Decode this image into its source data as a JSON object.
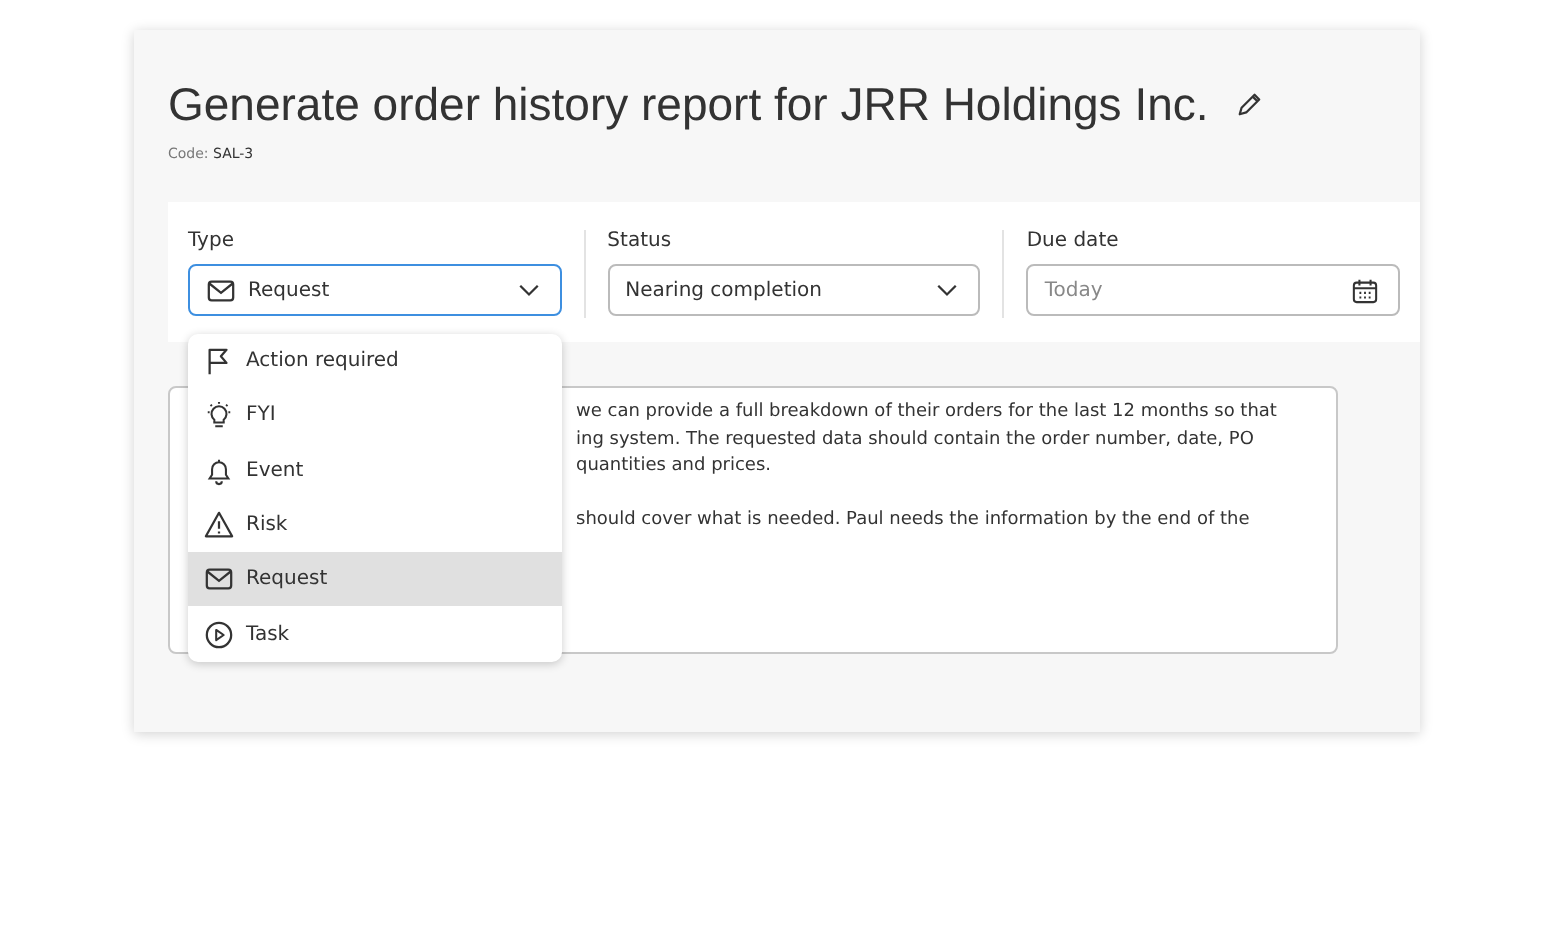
{
  "title": "Generate order history report for JRR Holdings Inc.",
  "code": {
    "label": "Code:",
    "value": "SAL-3"
  },
  "fields": [
    {
      "kind": "select",
      "label": "Type",
      "value": "Request",
      "open": true
    },
    {
      "kind": "select",
      "label": "Status",
      "value": "Nearing completion",
      "open": false
    },
    {
      "kind": "date",
      "label": "Due date",
      "placeholder": "Today"
    }
  ],
  "description_paragraphs": [
    [
      "we can provide a full breakdown of their orders for the last 12 months so that",
      "ing system. The requested data should contain the order number, date, PO",
      "quantities and prices."
    ],
    [
      "should cover what is needed. Paul needs the information by the end of the"
    ]
  ],
  "type_options": [
    {
      "label": "Action required",
      "selected": false
    },
    {
      "label": "FYI",
      "selected": false
    },
    {
      "label": "Event",
      "selected": false
    },
    {
      "label": "Risk",
      "selected": false
    },
    {
      "label": "Request",
      "selected": true
    },
    {
      "label": "Task",
      "selected": false
    }
  ]
}
